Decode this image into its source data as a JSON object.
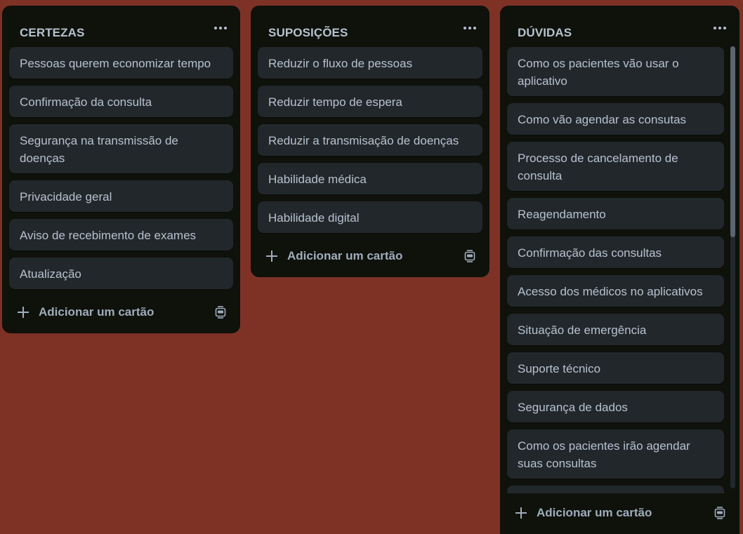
{
  "lists": [
    {
      "title": "CERTEZAS",
      "cards": [
        "Pessoas querem economizar tempo",
        "Confirmação da consulta",
        "Segurança na transmissão de doenças",
        "Privacidade geral",
        "Aviso de recebimento de exames",
        "Atualização"
      ],
      "add_label": "Adicionar um cartão"
    },
    {
      "title": "SUPOSIÇÕES",
      "cards": [
        "Reduzir o fluxo de pessoas",
        "Reduzir tempo de espera",
        "Reduzir a transmisação de doenças",
        "Habilidade médica",
        "Habilidade digital"
      ],
      "add_label": "Adicionar um cartão"
    },
    {
      "title": "DÚVIDAS",
      "cards": [
        "Como os pacientes vão usar o aplicativo",
        "Como vão agendar as consutas",
        "Processo de cancelamento de consulta",
        "Reagendamento",
        "Confirmação das consultas",
        "Acesso dos médicos no aplicativos",
        "Situação de emergência",
        "Suporte técnico",
        "Segurança de dados",
        "Como os pacientes irão agendar suas consultas",
        ""
      ],
      "add_label": "Adicionar um cartão"
    }
  ],
  "icons": {
    "list_menu": "more-horizontal-icon",
    "add": "plus-icon",
    "template": "card-template-icon"
  },
  "colors": {
    "board_background": "#7e3226",
    "list_background": "#0f110b",
    "card_background": "#22272b",
    "text": "#b6c2cf"
  }
}
